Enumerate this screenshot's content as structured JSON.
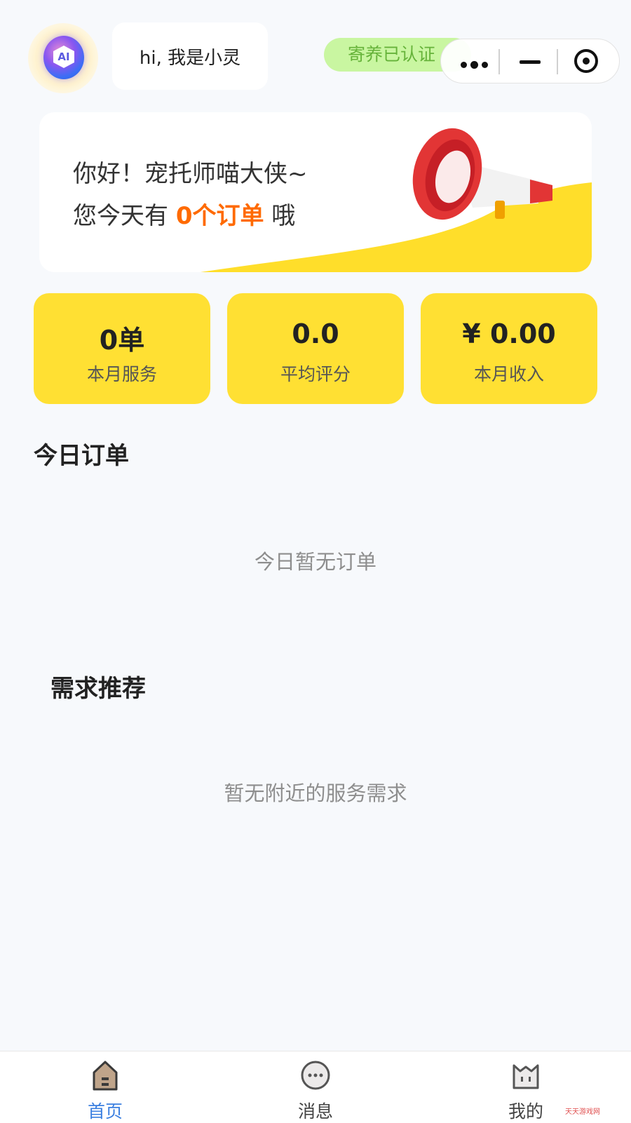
{
  "header": {
    "ai_avatar_text": "AI",
    "greeting_bubble": "hi, 我是小灵",
    "cert_badge": "寄养已认证",
    "capsule_icons": [
      "more-icon",
      "minimize-icon",
      "target-icon"
    ]
  },
  "banner": {
    "line1": "你好！宠托师喵大侠~",
    "line2_prefix": "您今天有 ",
    "line2_highlight": "0个订单",
    "line2_suffix": " 哦",
    "icon": "megaphone-icon"
  },
  "stats": [
    {
      "value": "0单",
      "label": "本月服务"
    },
    {
      "value": "0.0",
      "label": "平均评分"
    },
    {
      "value": "¥ 0.00",
      "label": "本月收入"
    }
  ],
  "today_orders": {
    "title": "今日订单",
    "empty": "今日暂无订单"
  },
  "demand": {
    "title": "需求推荐",
    "empty": "暂无附近的服务需求"
  },
  "tabbar": {
    "items": [
      {
        "label": "首页",
        "icon": "home-icon",
        "active": true
      },
      {
        "label": "消息",
        "icon": "message-icon",
        "active": false
      },
      {
        "label": "我的",
        "icon": "profile-icon",
        "active": false
      }
    ]
  },
  "watermark": "天天游戏网",
  "colors": {
    "accent_yellow": "#ffe033",
    "highlight_orange": "#ff6a00",
    "cert_green_bg": "#c9f6a1",
    "cert_green_text": "#66b33a",
    "tab_active": "#3b7fe0"
  }
}
